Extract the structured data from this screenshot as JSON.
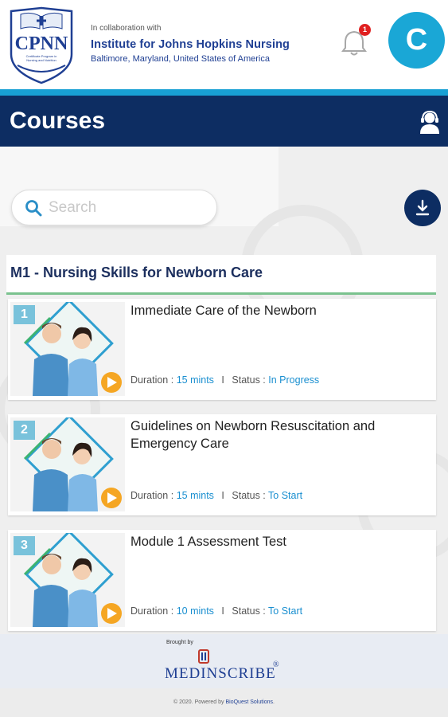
{
  "header": {
    "logo_text": "CPNN",
    "logo_subtext": "Certificate Program in Nursing and Nutrition",
    "collab_label": "In collaboration with",
    "institute": "Institute for Johns Hopkins Nursing",
    "location": "Baltimore, Maryland, United States of America",
    "notification_count": "1",
    "avatar_letter": "C"
  },
  "page": {
    "title": "Courses"
  },
  "search": {
    "placeholder": "Search"
  },
  "module": {
    "title": "M1 - Nursing Skills for Newborn Care"
  },
  "labels": {
    "duration": "Duration :",
    "status": "Status :",
    "separator": "I"
  },
  "courses": [
    {
      "number": "1",
      "title": "Immediate Care of the Newborn",
      "duration": "15 mints",
      "status": "In Progress"
    },
    {
      "number": "2",
      "title": "Guidelines on Newborn Resuscitation and Emergency Care",
      "duration": "15 mints",
      "status": "To Start"
    },
    {
      "number": "3",
      "title": "Module 1 Assessment Test",
      "duration": "10 mints",
      "status": "To Start"
    }
  ],
  "footer": {
    "brought_by": "Brought by",
    "sponsor": "MEDINSCRIBE",
    "reg_mark": "®",
    "copyright_prefix": "© 2020. Powered by ",
    "powered_by": "BioQuest Solutions",
    "copyright_suffix": "."
  },
  "colors": {
    "navy": "#0d2d62",
    "accent_blue": "#18a0d4",
    "avatar": "#1aa7d6",
    "link_blue": "#1a8fd0",
    "play_orange": "#f5a623",
    "divider_green": "#7ac28e",
    "badge_red": "#e02020"
  },
  "icons": {
    "notification": "bell-icon",
    "support": "support-agent-icon",
    "search": "search-icon",
    "download": "download-icon",
    "play": "play-icon"
  }
}
